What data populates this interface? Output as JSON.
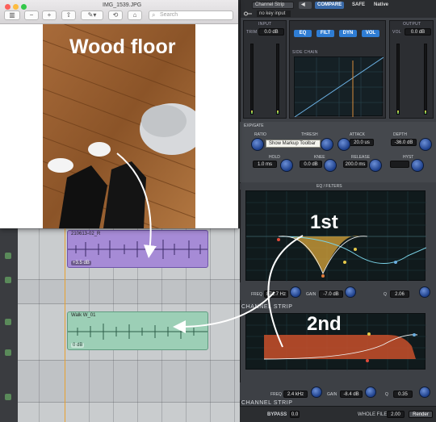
{
  "preview": {
    "title": "IMG_1539.JPG",
    "search_placeholder": "Search",
    "photo_caption": "Wood floor"
  },
  "clips": [
    {
      "name": "210613-02_R",
      "gain": "+3.5 dB",
      "color": "#a68bd6"
    },
    {
      "name": "Walk W_01",
      "gain": "0 dB",
      "color": "#9ccfb6"
    }
  ],
  "plugin": {
    "channel_select": "Channel Strip",
    "compare_label": "COMPARE",
    "safe_label": "SAFE",
    "native_label": "Native",
    "key_input": "no key input",
    "input_title": "INPUT",
    "input_trim_label": "TRIM",
    "input_trim_value": "0.0 dB",
    "output_title": "OUTPUT",
    "output_vol_label": "VOL",
    "output_vol_value": "0.0 dB",
    "chain_buttons": [
      "EQ",
      "FILT",
      "DYN",
      "VOL"
    ],
    "sidechain_label": "SIDE CHAIN",
    "expgate_label": "EXP/GATE",
    "tooltip": "Show Markup Toolbar",
    "dyn": {
      "ratio_label": "RATIO",
      "thresh_label": "THRESH",
      "attack_label": "ATTACK",
      "attack_value": "20.0 us",
      "depth_label": "DEPTH",
      "depth_value": "-36.0 dB",
      "hold_label": "HOLD",
      "hold_value": "1.0 ms",
      "knee_label": "KNEE",
      "knee_value": "0.0 dB",
      "release_label": "RELEASE",
      "release_value": "200.0 ms",
      "hyst_label": "HYST"
    },
    "eq_filters_label": "EQ / FILTERS",
    "band1": {
      "freq_label": "FREQ",
      "freq_value": "871.7 Hz",
      "gain_label": "GAIN",
      "gain_value": "-7.0 dB",
      "q_label": "Q",
      "q_value": "2.06"
    },
    "band2": {
      "freq_label": "FREQ",
      "freq_value": "2.4 kHz",
      "gain_label": "GAIN",
      "gain_value": "-8.4 dB",
      "q_label": "Q",
      "q_value": "0.35"
    },
    "strip_title": "CHANNEL STRIP",
    "bypass_label": "BYPASS",
    "bypass_value": "0.0",
    "whole_file_label": "WHOLE FILE",
    "whole_file_value": "2.00",
    "render_label": "Render"
  },
  "annotations": {
    "first": "1st",
    "second": "2nd"
  },
  "colors": {
    "accent_blue": "#2f7dd4",
    "eq_orange": "#c8502a",
    "eq_gold": "#d9a63a"
  }
}
